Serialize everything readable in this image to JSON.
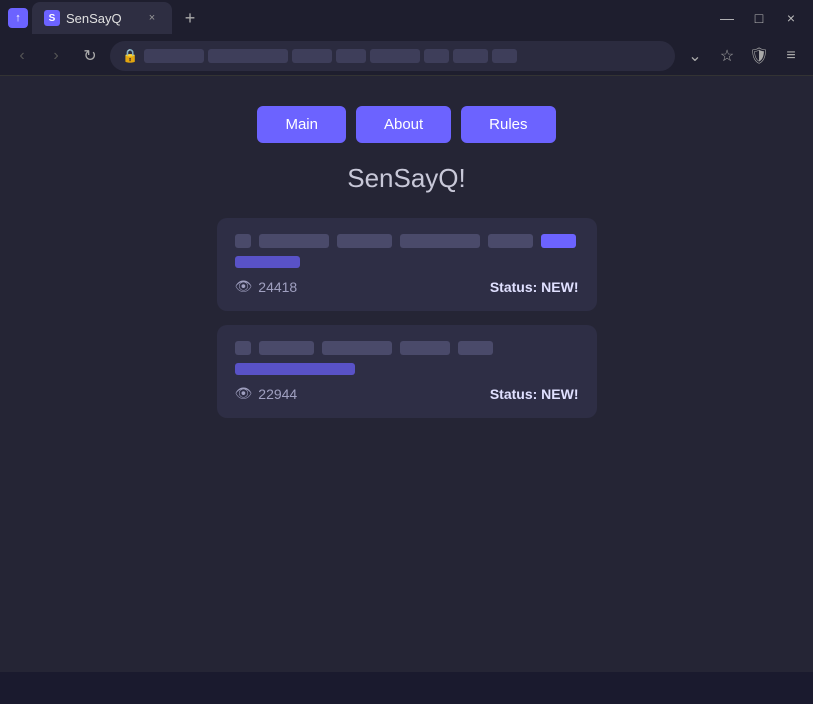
{
  "browser": {
    "tab": {
      "favicon_letter": "S",
      "title": "SenSayQ",
      "close_symbol": "×"
    },
    "new_tab_symbol": "+",
    "window_controls": {
      "minimize": "—",
      "maximize": "□",
      "close": "×"
    },
    "nav": {
      "back_symbol": "‹",
      "forward_symbol": "›",
      "refresh_symbol": "↻"
    },
    "dropdown_symbol": "⌄",
    "bookmark_symbol": "☆",
    "shield_symbol": "🛡",
    "menu_symbol": "≡"
  },
  "ext_icon_letter": "↑",
  "page": {
    "title": "SenSayQ!",
    "nav_buttons": [
      {
        "label": "Main",
        "id": "main"
      },
      {
        "label": "About",
        "id": "about"
      },
      {
        "label": "Rules",
        "id": "rules"
      }
    ],
    "cards": [
      {
        "views": "24418",
        "status_label": "Status:",
        "status_value": "NEW!"
      },
      {
        "views": "22944",
        "status_label": "Status:",
        "status_value": "NEW!"
      }
    ]
  }
}
